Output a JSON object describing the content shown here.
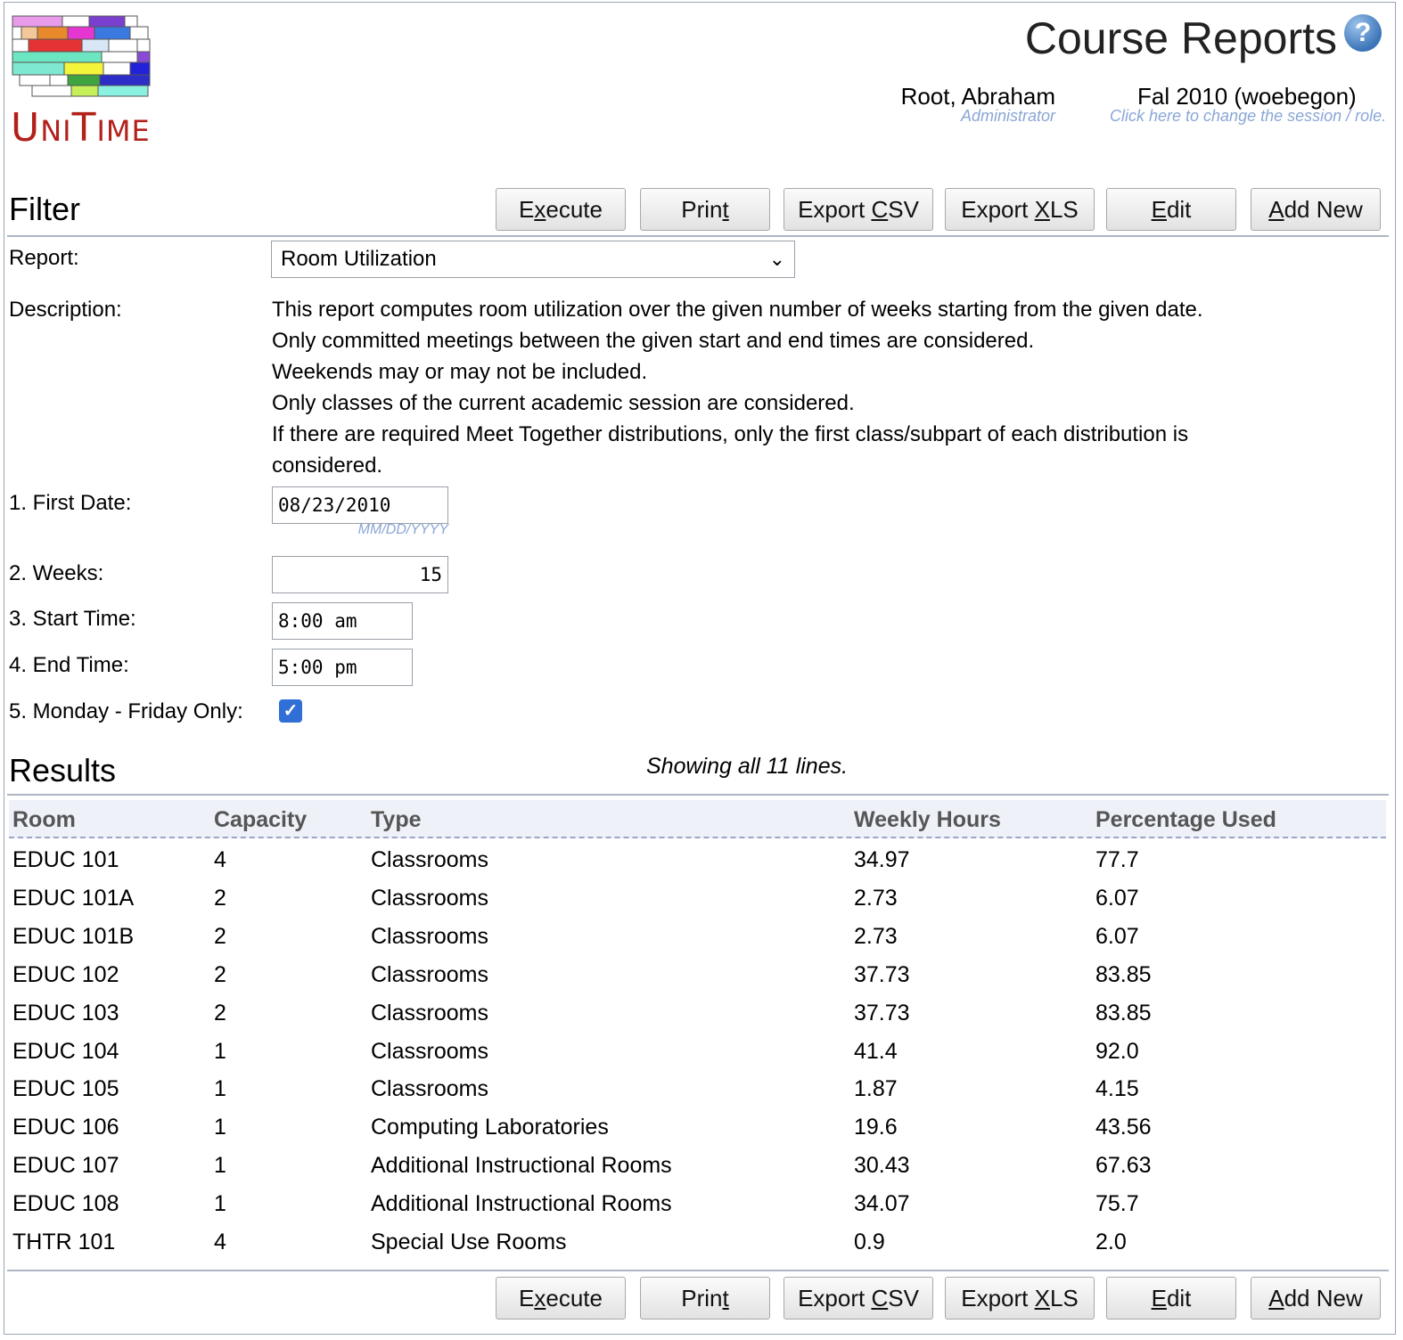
{
  "header": {
    "title": "Course Reports",
    "logo_text": "UniTime",
    "user": {
      "name": "Root, Abraham",
      "role": "Administrator"
    },
    "session": {
      "name": "Fal 2010 (woebegon)",
      "hint": "Click here to change the session / role."
    }
  },
  "filter": {
    "title": "Filter",
    "buttons": {
      "execute": {
        "pre": "E",
        "key": "x",
        "post": "ecute"
      },
      "print": {
        "pre": "Prin",
        "key": "t",
        "post": ""
      },
      "export_csv": {
        "pre": "Export ",
        "key": "C",
        "post": "SV"
      },
      "export_xls": {
        "pre": "Export ",
        "key": "X",
        "post": "LS"
      },
      "edit": {
        "pre": "",
        "key": "E",
        "post": "dit"
      },
      "add_new": {
        "pre": "",
        "key": "A",
        "post": "dd New"
      }
    },
    "report_label": "Report:",
    "report_value": "Room Utilization",
    "description_label": "Description:",
    "description_lines": [
      "This report computes room utilization over the given number of weeks starting from the given date.",
      "Only committed meetings between the given start and end times are considered.",
      "Weekends may or may not be included.",
      "Only classes of the current academic session are considered.",
      "If there are required Meet Together distributions, only the first class/subpart of each distribution is",
      "considered."
    ],
    "params": {
      "first_date": {
        "label": "1. First Date:",
        "value": "08/23/2010",
        "hint": "MM/DD/YYYY"
      },
      "weeks": {
        "label": "2. Weeks:",
        "value": "15"
      },
      "start_time": {
        "label": "3. Start Time:",
        "value": "8:00 am"
      },
      "end_time": {
        "label": "4. End Time:",
        "value": "5:00 pm"
      },
      "mon_fri": {
        "label": "5. Monday - Friday Only:",
        "checked": true
      }
    }
  },
  "results": {
    "title": "Results",
    "showing": "Showing all 11 lines.",
    "columns": [
      "Room",
      "Capacity",
      "Type",
      "Weekly Hours",
      "Percentage Used"
    ],
    "rows": [
      [
        "EDUC 101",
        "4",
        "Classrooms",
        "34.97",
        "77.7"
      ],
      [
        "EDUC 101A",
        "2",
        "Classrooms",
        "2.73",
        "6.07"
      ],
      [
        "EDUC 101B",
        "2",
        "Classrooms",
        "2.73",
        "6.07"
      ],
      [
        "EDUC 102",
        "2",
        "Classrooms",
        "37.73",
        "83.85"
      ],
      [
        "EDUC 103",
        "2",
        "Classrooms",
        "37.73",
        "83.85"
      ],
      [
        "EDUC 104",
        "1",
        "Classrooms",
        "41.4",
        "92.0"
      ],
      [
        "EDUC 105",
        "1",
        "Classrooms",
        "1.87",
        "4.15"
      ],
      [
        "EDUC 106",
        "1",
        "Computing Laboratories",
        "19.6",
        "43.56"
      ],
      [
        "EDUC 107",
        "1",
        "Additional Instructional Rooms",
        "30.43",
        "67.63"
      ],
      [
        "EDUC 108",
        "1",
        "Additional Instructional Rooms",
        "34.07",
        "75.7"
      ],
      [
        "THTR 101",
        "4",
        "Special Use Rooms",
        "0.9",
        "2.0"
      ]
    ]
  }
}
